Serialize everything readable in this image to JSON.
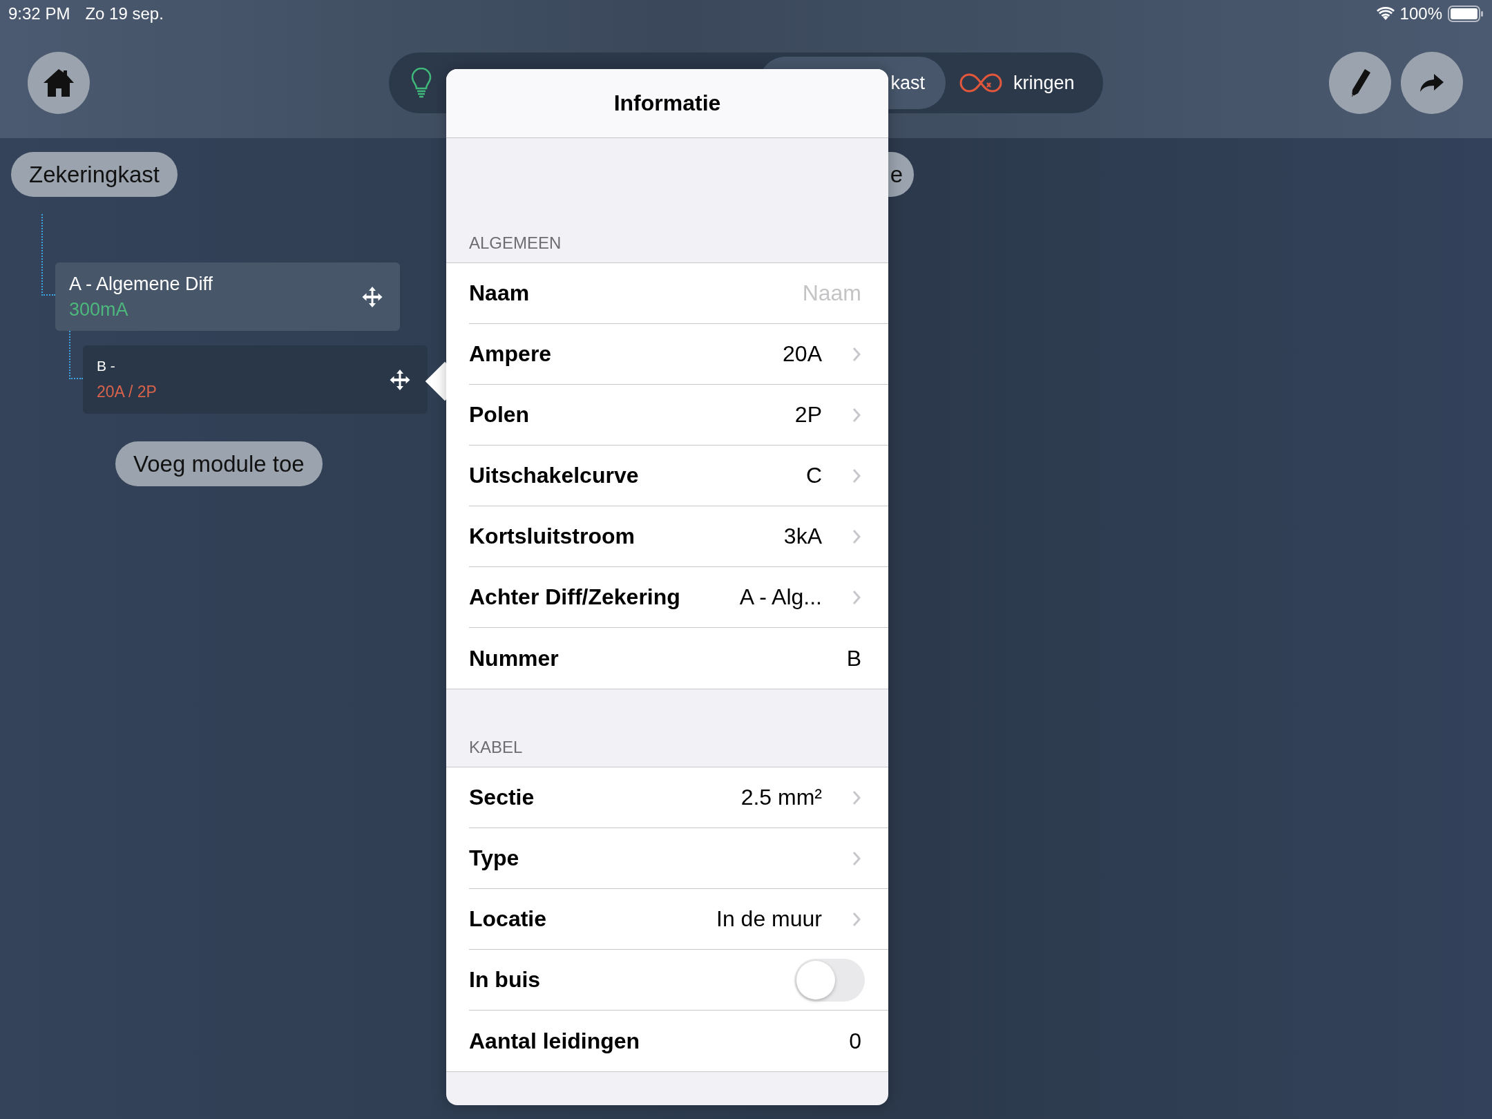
{
  "status_bar": {
    "time": "9:32 PM",
    "date": "Zo 19 sep.",
    "battery": "100%"
  },
  "toolbar": {
    "segments": [
      {
        "kind": "bulb",
        "selected": false
      },
      {
        "kind": "plain",
        "label": "kast",
        "selected": true
      },
      {
        "kind": "circuit",
        "label": "kringen",
        "selected": false
      }
    ]
  },
  "tree": {
    "root": "Zekeringkast",
    "modules": [
      {
        "title": "A - Algemene Diff",
        "detail": "300mA",
        "color": "#4cb87c",
        "selected": false,
        "children": [
          {
            "title": "B -",
            "detail": "20A / 2P",
            "color": "#d9634a",
            "selected": true
          }
        ]
      }
    ],
    "add_button": "Voeg module toe",
    "side_pill": "e"
  },
  "popover": {
    "title": "Informatie",
    "sections": [
      {
        "header": "ALGEMEEN",
        "rows": [
          {
            "kind": "field",
            "label": "Naam",
            "placeholder": "Naam"
          },
          {
            "kind": "disclosure",
            "label": "Ampere",
            "value": "20A"
          },
          {
            "kind": "disclosure",
            "label": "Polen",
            "value": "2P"
          },
          {
            "kind": "disclosure",
            "label": "Uitschakelcurve",
            "value": "C"
          },
          {
            "kind": "disclosure",
            "label": "Kortsluitstroom",
            "value": "3kA"
          },
          {
            "kind": "disclosure",
            "label": "Achter Diff/Zekering",
            "value": "A - Alg..."
          },
          {
            "kind": "value",
            "label": "Nummer",
            "value": "B"
          }
        ]
      },
      {
        "header": "KABEL",
        "rows": [
          {
            "kind": "disclosure",
            "label": "Sectie",
            "value": "2.5 mm²"
          },
          {
            "kind": "disclosure",
            "label": "Type"
          },
          {
            "kind": "disclosure",
            "label": "Locatie",
            "value": "In de muur"
          },
          {
            "kind": "toggle",
            "label": "In buis",
            "on": false
          },
          {
            "kind": "value",
            "label": "Aantal leidingen",
            "value": "0"
          }
        ]
      }
    ]
  }
}
